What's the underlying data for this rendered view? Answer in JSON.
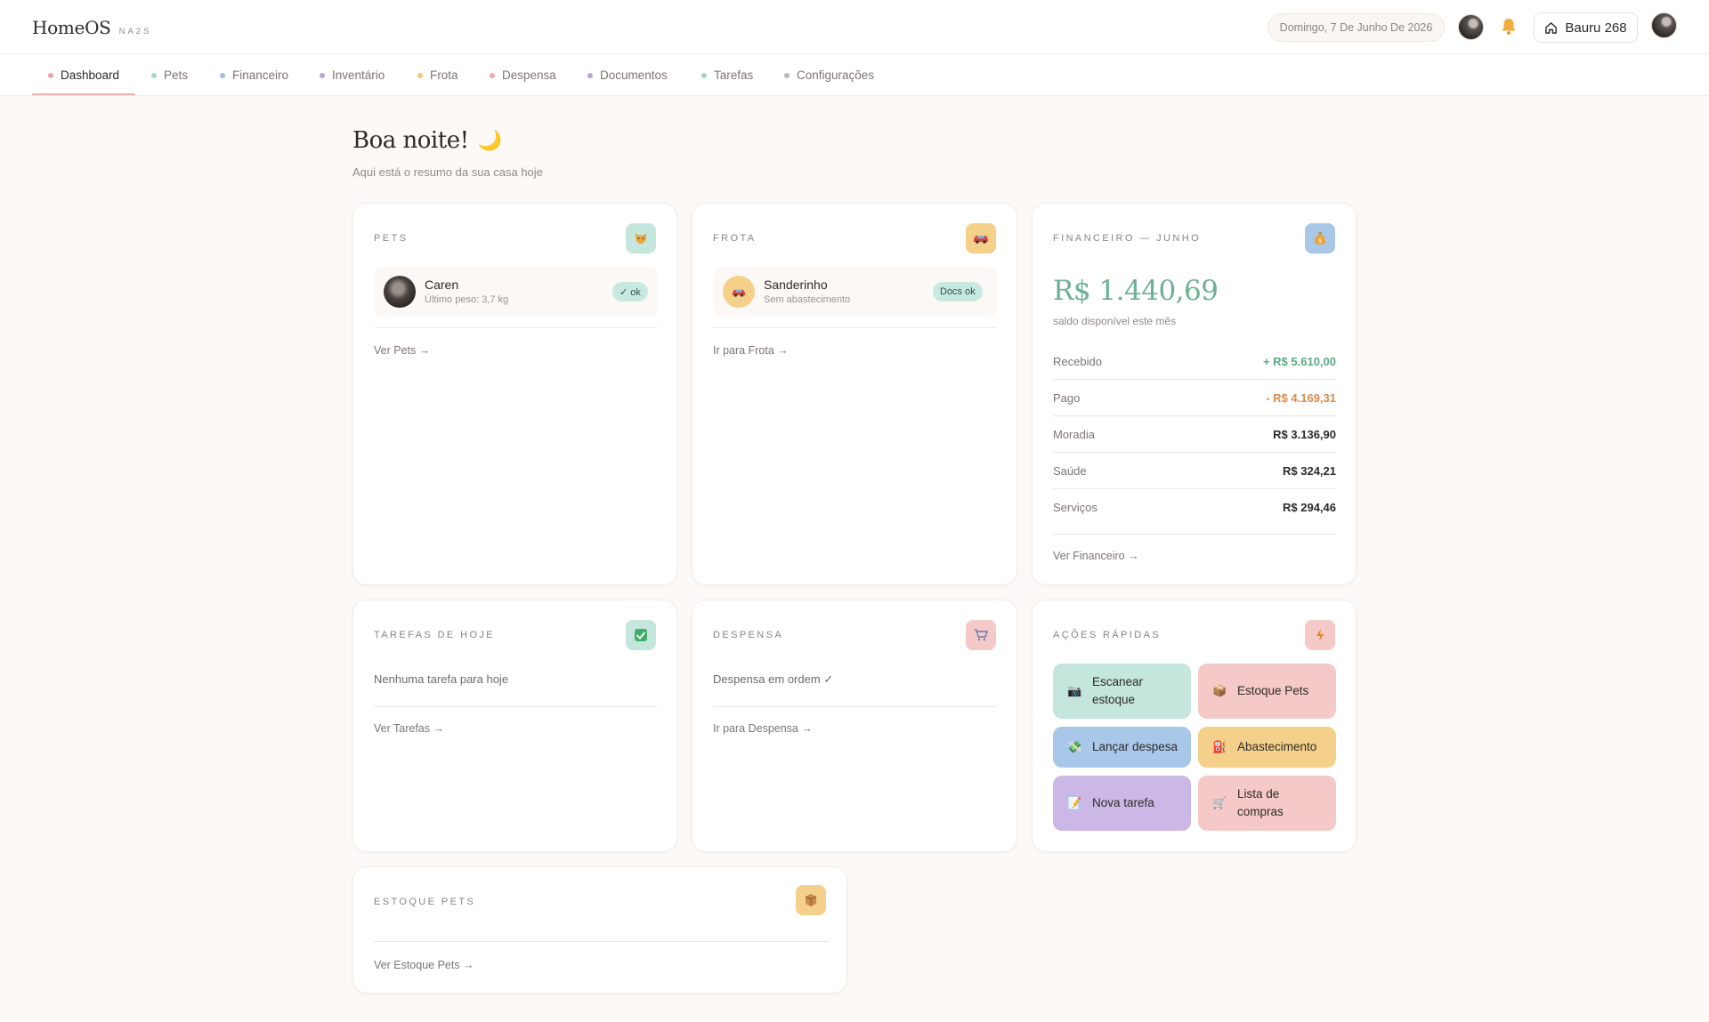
{
  "app": {
    "title": "HomeOS",
    "subtitle": "NA2S"
  },
  "header": {
    "date": "Domingo, 7 De Junho De 2026",
    "home_label": "Bauru 268"
  },
  "nav": {
    "items": [
      {
        "label": "Dashboard",
        "color": "#e9a5a2",
        "active": true
      },
      {
        "label": "Pets",
        "color": "#a9d6cb"
      },
      {
        "label": "Financeiro",
        "color": "#9fbfe0"
      },
      {
        "label": "Inventário",
        "color": "#b7a6d8"
      },
      {
        "label": "Frota",
        "color": "#f1c878"
      },
      {
        "label": "Despensa",
        "color": "#eeaaa6"
      },
      {
        "label": "Documentos",
        "color": "#b9a3d9"
      },
      {
        "label": "Tarefas",
        "color": "#9fd6c9"
      },
      {
        "label": "Configurações",
        "color": "#bdb8b4"
      }
    ]
  },
  "greeting": {
    "title": "Boa noite!",
    "emoji": "🌙",
    "subtitle": "Aqui está o resumo da sua casa hoje"
  },
  "pets": {
    "label": "PETS",
    "icon": "cat-icon",
    "item": {
      "name": "Caren",
      "sub": "Último peso: 3,7 kg",
      "badge": "✓ ok"
    },
    "link": "Ver Pets →"
  },
  "frota": {
    "label": "FROTA",
    "icon": "car-icon",
    "item": {
      "name": "Sanderinho",
      "sub": "Sem abastecimento",
      "badge": "Docs ok"
    },
    "link": "Ir para Frota →"
  },
  "financeiro": {
    "label": "FINANCEIRO — JUNHO",
    "icon": "money-bag-icon",
    "amount": "R$ 1.440,69",
    "amount_sub": "saldo disponível este mês",
    "rows": [
      {
        "label": "Recebido",
        "value": "+ R$ 5.610,00",
        "color": "#5aa883"
      },
      {
        "label": "Pago",
        "value": "- R$ 4.169,31",
        "color": "#d98a4c"
      },
      {
        "label": "Moradia",
        "value": "R$ 3.136,90",
        "color": "#2d2a28"
      },
      {
        "label": "Saúde",
        "value": "R$ 324,21",
        "color": "#2d2a28"
      },
      {
        "label": "Serviços",
        "value": "R$ 294,46",
        "color": "#2d2a28"
      }
    ],
    "link": "Ver Financeiro →"
  },
  "tarefas": {
    "label": "TAREFAS DE HOJE",
    "icon": "check-icon",
    "empty": "Nenhuma tarefa para hoje",
    "link": "Ver Tarefas →"
  },
  "despensa": {
    "label": "DESPENSA",
    "icon": "cart-icon",
    "empty": "Despensa em ordem ✓",
    "link": "Ir para Despensa →"
  },
  "acoes": {
    "label": "AÇÕES RÁPIDAS",
    "icon": "lightning-icon",
    "items": [
      {
        "label": "Escanear estoque",
        "icon": "📷",
        "color": "#c4e6dd"
      },
      {
        "label": "Estoque Pets",
        "icon": "📦",
        "color": "#f5c9c8"
      },
      {
        "label": "Lançar despesa",
        "icon": "💸",
        "color": "#a9c7e8"
      },
      {
        "label": "Abastecimento",
        "icon": "⛽",
        "color": "#f4d08a"
      },
      {
        "label": "Nova tarefa",
        "icon": "📝",
        "color": "#cbb8e6"
      },
      {
        "label": "Lista de compras",
        "icon": "🛒",
        "color": "#f5c9c8"
      }
    ]
  },
  "estoque_pets": {
    "label": "ESTOQUE PETS",
    "icon": "package-icon",
    "link": "Ver Estoque Pets →"
  }
}
